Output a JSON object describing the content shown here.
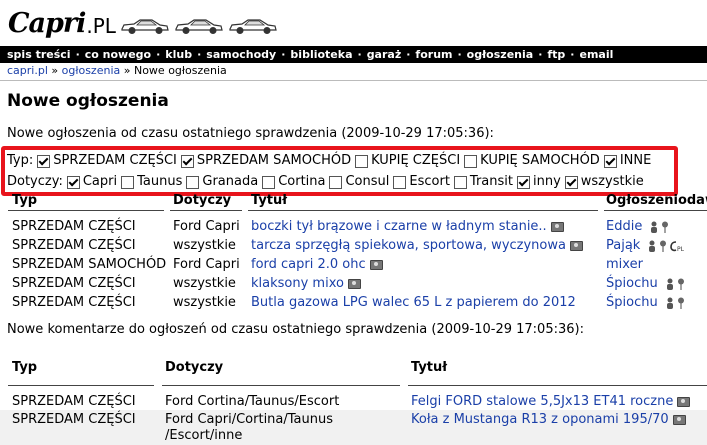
{
  "header": {
    "logo_script": "Capri",
    "logo_suffix": ".PL"
  },
  "nav": [
    "spis treści",
    "co nowego",
    "klub",
    "samochody",
    "biblioteka",
    "garaż",
    "forum",
    "ogłoszenia",
    "ftp",
    "email"
  ],
  "breadcrumb": {
    "home": "capri.pl",
    "sep1": " » ",
    "section": "ogłoszenia",
    "sep2": " » ",
    "current": "Nowe ogłoszenia"
  },
  "page_title": "Nowe ogłoszenia",
  "since_text": "Nowe ogłoszenia od czasu ostatniego sprawdzenia (2009-10-29 17:05:36):",
  "filters": {
    "type_label": "Typ:",
    "type_options": [
      {
        "label": "SPRZEDAM CZĘŚCI",
        "checked": true
      },
      {
        "label": "SPRZEDAM SAMOCHÓD",
        "checked": true
      },
      {
        "label": "KUPIĘ CZĘŚCI",
        "checked": false
      },
      {
        "label": "KUPIĘ SAMOCHÓD",
        "checked": false
      },
      {
        "label": "INNE",
        "checked": true
      }
    ],
    "concerns_label": "Dotyczy:",
    "concerns_options": [
      {
        "label": "Capri",
        "checked": true
      },
      {
        "label": "Taunus",
        "checked": false
      },
      {
        "label": "Granada",
        "checked": false
      },
      {
        "label": "Cortina",
        "checked": false
      },
      {
        "label": "Consul",
        "checked": false
      },
      {
        "label": "Escort",
        "checked": false
      },
      {
        "label": "Transit",
        "checked": false
      },
      {
        "label": "inny",
        "checked": true
      },
      {
        "label": "wszystkie",
        "checked": true
      }
    ]
  },
  "ads_table": {
    "headers": {
      "type": "Typ",
      "concerns": "Dotyczy",
      "title": "Tytuł",
      "author": "Ogłoszeniodaw"
    },
    "rows": [
      {
        "type": "SPRZEDAM CZĘŚCI",
        "concerns": "Ford Capri",
        "title": "boczki tył brązowe i czarne w ładnym stanie..",
        "author": "Eddie",
        "logo": false
      },
      {
        "type": "SPRZEDAM CZĘŚCI",
        "concerns": "wszystkie",
        "title": "tarcza sprzęgłą spiekowa, sportowa, wyczynowa",
        "author": "Pająk",
        "logo": true
      },
      {
        "type": "SPRZEDAM SAMOCHÓD",
        "concerns": "Ford Capri",
        "title": "ford capri 2.0 ohc",
        "author": "mixer",
        "logo": false
      },
      {
        "type": "SPRZEDAM CZĘŚCI",
        "concerns": "wszystkie",
        "title": "klaksony mixo",
        "author": "Śpiochu",
        "logo": false
      },
      {
        "type": "SPRZEDAM CZĘŚCI",
        "concerns": "wszystkie",
        "title": "Butla gazowa LPG walec 65 L z papierem do 2012",
        "author": "Śpiochu",
        "logo": false
      }
    ]
  },
  "comments_text": "Nowe komentarze do ogłoszeń od czasu ostatniego sprawdzenia (2009-10-29 17:05:36):",
  "comments_table": {
    "headers": {
      "type": "Typ",
      "concerns": "Dotyczy",
      "title": "Tytuł"
    },
    "rows": [
      {
        "type": "SPRZEDAM CZĘŚCI",
        "concerns_1": "Ford Cortina/Taunus/Escort",
        "concerns_2": "",
        "title": "Felgi FORD stalowe 5,5Jx13 ET41 roczne"
      },
      {
        "type": "SPRZEDAM CZĘŚCI",
        "concerns_1": "Ford Capri/Cortina/Taunus",
        "concerns_2": "/Escort/inne",
        "title": "Koła z Mustanga R13 z oponami 195/70"
      }
    ]
  }
}
